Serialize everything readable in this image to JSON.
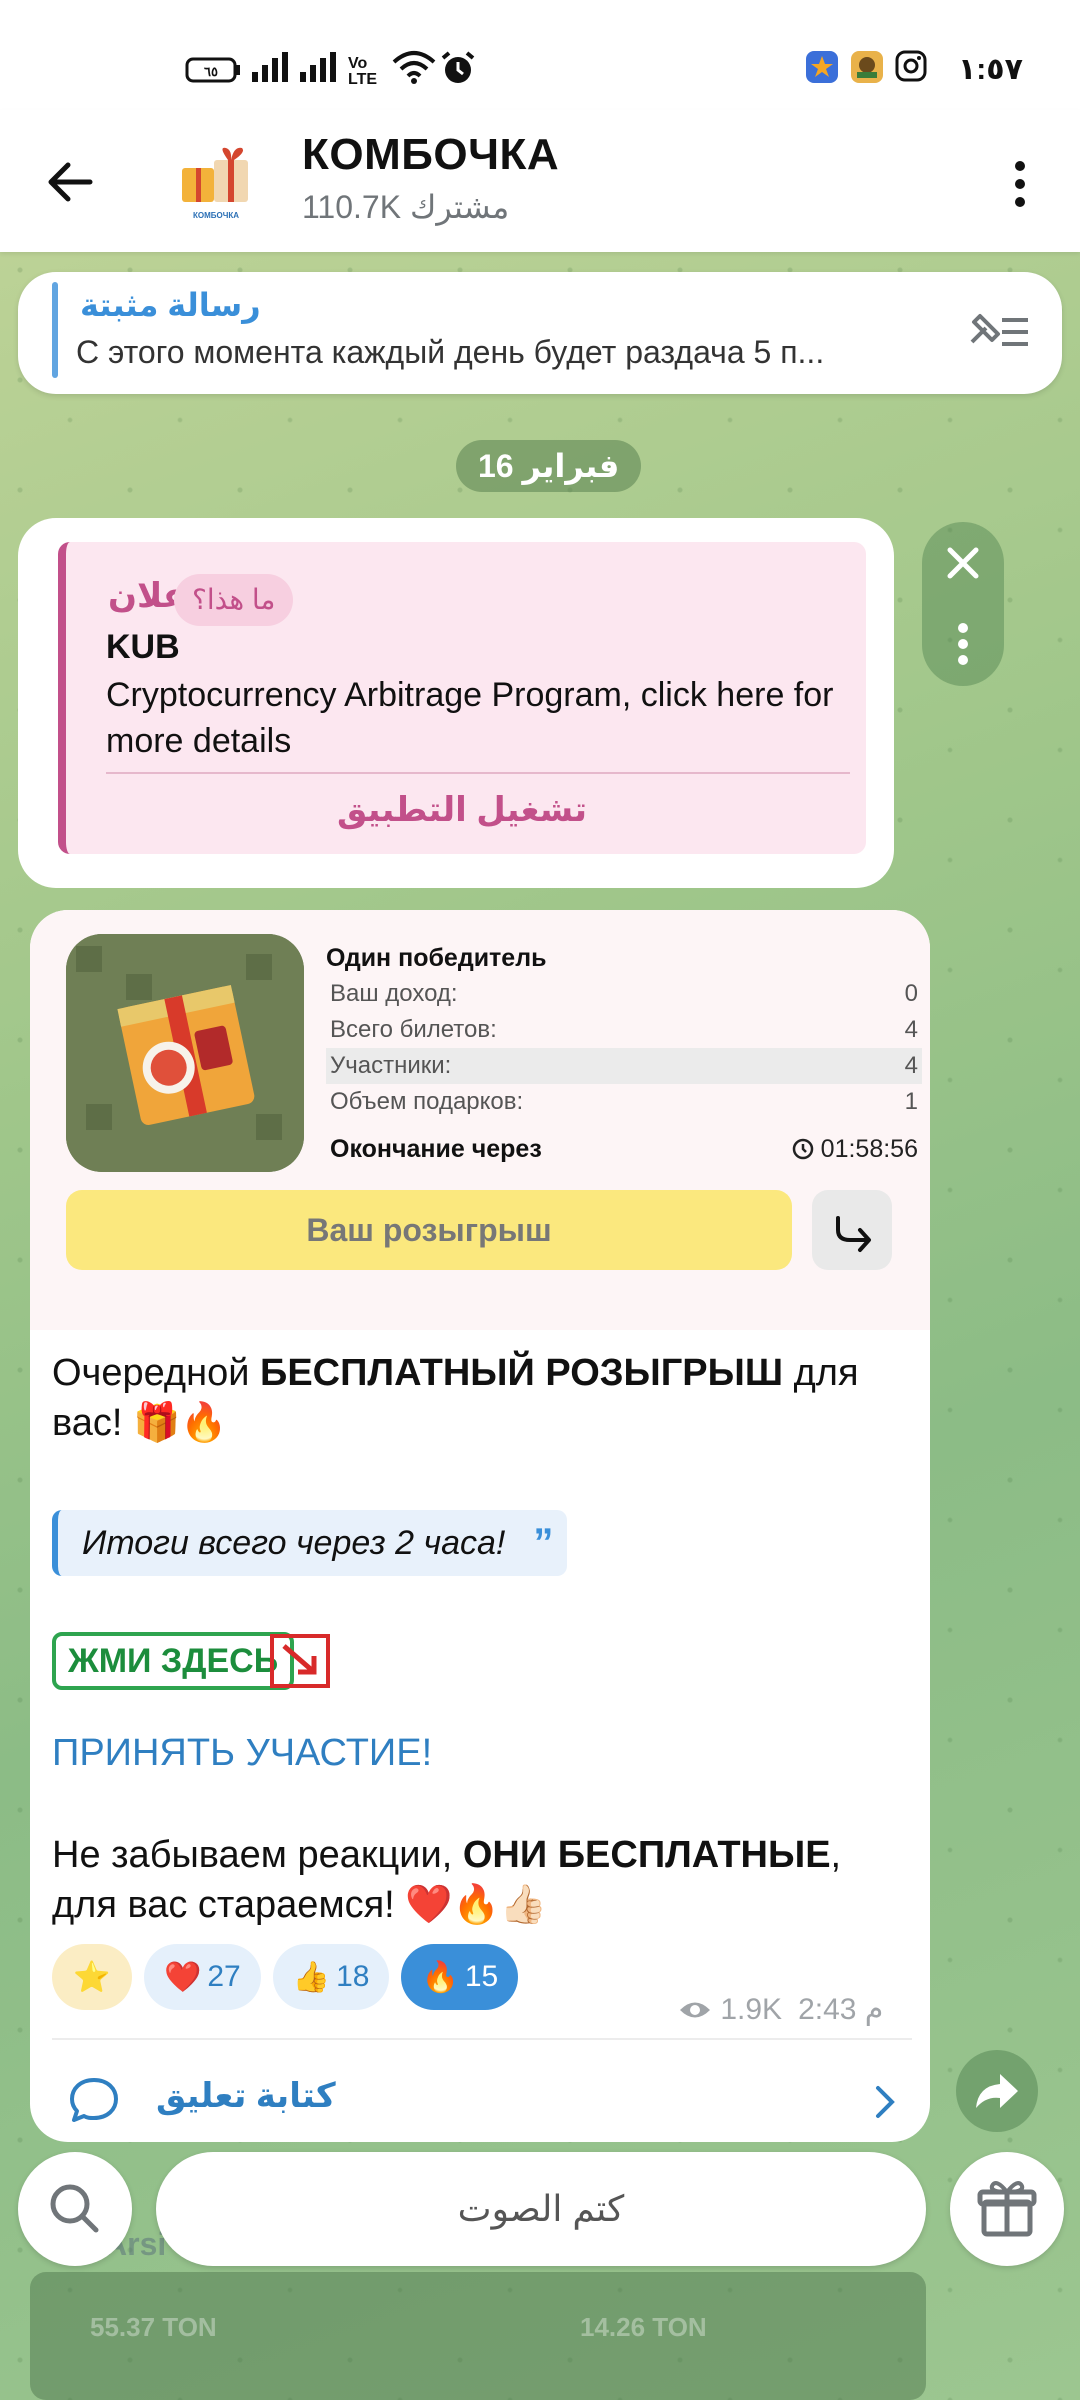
{
  "status_bar": {
    "time": "١:٥٧",
    "battery": "٦٥",
    "volte": "Vo LTE"
  },
  "header": {
    "title": "КОМБОЧКА",
    "subtitle": "110.7K مشترك",
    "avatar_caption": "КОМБОЧКА"
  },
  "pinned": {
    "title": "رسالة مثبتة",
    "text": "С этого момента каждый день будет раздача 5 п..."
  },
  "date_separator": "16 فبراير",
  "ad": {
    "label": "إعلان",
    "what_is_this": "ما هذا؟",
    "sponsor": "KUB",
    "text": "Cryptocurrency Arbitrage Program, click here for more details",
    "button": "تشغيل التطبيق"
  },
  "giveaway": {
    "heading": "Один победитель",
    "rows": [
      {
        "label": "Ваш доход:",
        "value": "0"
      },
      {
        "label": "Всего билетов:",
        "value": "4"
      },
      {
        "label": "Участники:",
        "value": "4"
      },
      {
        "label": "Объем подарков:",
        "value": "1"
      }
    ],
    "end_label": "Окончание через",
    "end_time": "01:58:56",
    "button": "Ваш розыгрыш"
  },
  "post": {
    "line1_pre": "Очередной ",
    "line1_bold": "БЕСПЛАТНЫЙ РОЗЫГРЫШ",
    "line1_post": " для вас! 🎁🔥",
    "quote": "Итоги всего через 2 часа!",
    "press_here": "ЖМИ ЗДЕСЬ",
    "join_link": "ПРИНЯТЬ УЧАСТИЕ!",
    "line2_pre": "Не забываем реакции, ",
    "line2_bold": "ОНИ БЕСПЛАТНЫЕ",
    "line2_post": ", для вас стараемся! ❤️🔥👍🏻"
  },
  "reactions": [
    {
      "emoji": "⭐",
      "count": ""
    },
    {
      "emoji": "❤️",
      "count": "27"
    },
    {
      "emoji": "👍",
      "count": "18"
    },
    {
      "emoji": "🔥",
      "count": "15"
    }
  ],
  "meta": {
    "views": "1.9K",
    "time": "2:43 م"
  },
  "comment": {
    "label": "كتابة تعليق"
  },
  "bottom": {
    "mute": "كتم الصوت"
  },
  "background_peek": {
    "text1": "55.37 TON",
    "text2": "14.26 TON",
    "text3": "Arsi"
  },
  "colors": {
    "accent": "#3a8fd9",
    "ad_accent": "#c2508a",
    "giveaway_button": "#fbe87e",
    "press_green": "#2ea44f"
  }
}
